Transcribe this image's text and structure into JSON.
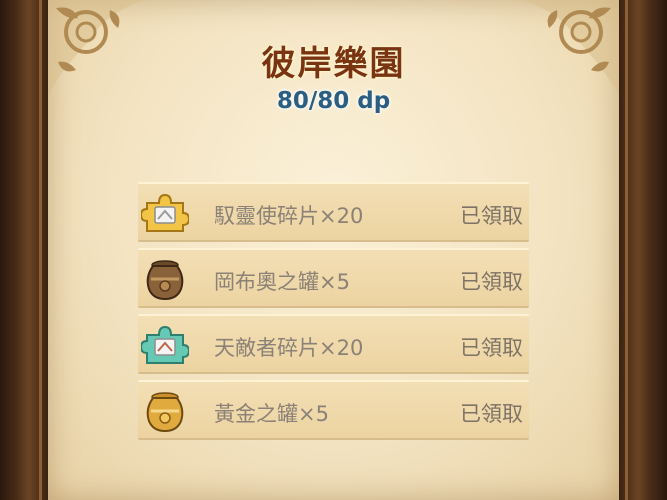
{
  "header": {
    "title": "彼岸樂園",
    "points": "80/80 dp"
  },
  "rewards": [
    {
      "name": "馭靈使碎片×20",
      "status": "已領取",
      "icon": "puzzle-piece-gold-icon"
    },
    {
      "name": "岡布奧之罐×5",
      "status": "已領取",
      "icon": "bronze-jar-icon"
    },
    {
      "name": "天敵者碎片×20",
      "status": "已領取",
      "icon": "puzzle-piece-teal-icon"
    },
    {
      "name": "黃金之罐×5",
      "status": "已領取",
      "icon": "gold-jar-icon"
    }
  ],
  "colors": {
    "title": "#7a3412",
    "points": "#2a5e82",
    "parchment": "#f3e3c1",
    "frame": "#4a2c17"
  }
}
